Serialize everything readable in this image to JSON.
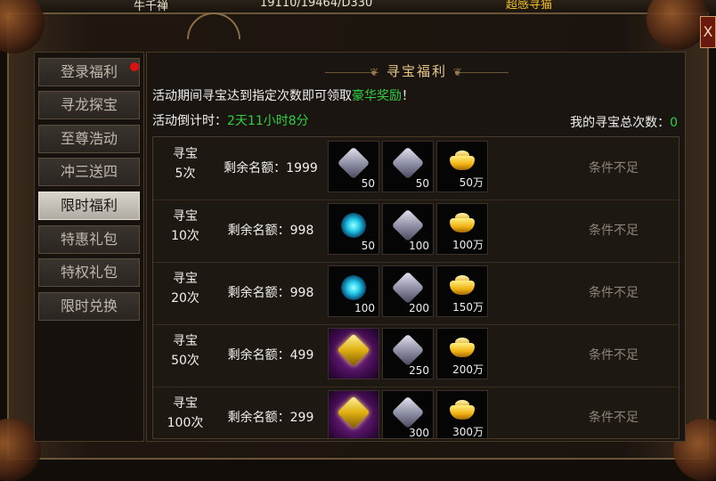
{
  "hud": {
    "name": "牛千禅",
    "stats": "19110/19464/D330",
    "right": "超感寻猫"
  },
  "sidebar": {
    "items": [
      {
        "label": "登录福利",
        "dot": true
      },
      {
        "label": "寻龙探宝"
      },
      {
        "label": "至尊浩动"
      },
      {
        "label": "冲三送四"
      },
      {
        "label": "限时福利",
        "active": true
      },
      {
        "label": "特惠礼包"
      },
      {
        "label": "特权礼包"
      },
      {
        "label": "限时兑换"
      }
    ]
  },
  "panel": {
    "title": "寻宝福利",
    "close_label": "X",
    "intro_prefix": "活动期间寻宝达到指定次数即可领取",
    "intro_highlight": "豪华奖励",
    "intro_suffix": "！",
    "countdown_label": "活动倒计时：",
    "countdown_value": "2天11小时8分",
    "total_label": "我的寻宝总次数：",
    "total_value": "0"
  },
  "rows": [
    {
      "times_top": "寻宝",
      "times_bottom": "5次",
      "quota": "剩余名额：1999",
      "rewards": [
        {
          "icon": "silver-gem-icon",
          "count": "50"
        },
        {
          "icon": "silver-gem-icon",
          "count": "50"
        },
        {
          "icon": "gold-ingot-icon",
          "count": "50万"
        }
      ],
      "status": "条件不足"
    },
    {
      "times_top": "寻宝",
      "times_bottom": "10次",
      "quota": "剩余名额：998",
      "rewards": [
        {
          "icon": "blue-orb-icon",
          "count": "50"
        },
        {
          "icon": "silver-gem-icon",
          "count": "100"
        },
        {
          "icon": "gold-ingot-icon",
          "count": "100万"
        }
      ],
      "status": "条件不足"
    },
    {
      "times_top": "寻宝",
      "times_bottom": "20次",
      "quota": "剩余名额：998",
      "rewards": [
        {
          "icon": "blue-orb-icon",
          "count": "100"
        },
        {
          "icon": "silver-gem-icon",
          "count": "200"
        },
        {
          "icon": "gold-ingot-icon",
          "count": "150万"
        }
      ],
      "status": "条件不足"
    },
    {
      "times_top": "寻宝",
      "times_bottom": "50次",
      "quota": "剩余名额：499",
      "rewards": [
        {
          "icon": "gold-crystal-icon",
          "count": ""
        },
        {
          "icon": "silver-gem-icon",
          "count": "250"
        },
        {
          "icon": "gold-ingot-icon",
          "count": "200万"
        }
      ],
      "status": "条件不足"
    },
    {
      "times_top": "寻宝",
      "times_bottom": "100次",
      "quota": "剩余名额：299",
      "rewards": [
        {
          "icon": "gold-crystal-icon",
          "count": ""
        },
        {
          "icon": "silver-gem-icon",
          "count": "300"
        },
        {
          "icon": "gold-ingot-icon",
          "count": "300万"
        }
      ],
      "status": "条件不足"
    }
  ]
}
